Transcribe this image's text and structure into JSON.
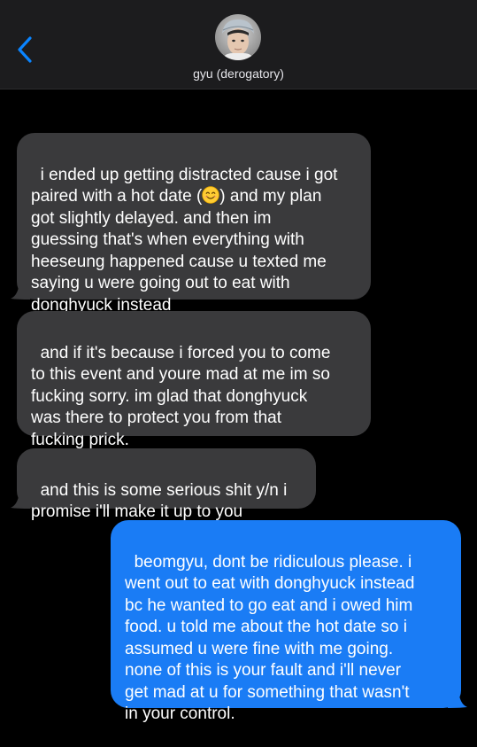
{
  "conversation": {
    "contact_name": "gyu (derogatory)"
  },
  "messages": [
    {
      "direction": "received",
      "text_before_emoji": "i ended up getting distracted cause i got\npaired with a hot date (",
      "emoji": "smiling-face",
      "text_after_emoji": ") and my plan\ngot slightly delayed. and then im\nguessing that's when everything with\nheeseung happened cause u texted me\nsaying u were going out to eat with\ndonghyuck instead"
    },
    {
      "direction": "received",
      "text": "and if it's because i forced you to come\nto this event and youre mad at me im so\nfucking sorry. im glad that donghyuck\nwas there to protect you from that\nfucking prick."
    },
    {
      "direction": "received",
      "text": "and this is some serious shit y/n i\npromise i'll make it up to you"
    },
    {
      "direction": "sent",
      "text": "beomgyu, dont be ridiculous please. i\nwent out to eat with donghyuck instead\nbc he wanted to go eat and i owed him\nfood. u told me about the hot date so i\nassumed u were fine with me going.\nnone of this is your fault and i'll never\nget mad at u for something that wasn't\nin your control."
    }
  ],
  "colors": {
    "received_bubble": "#3a3a3c",
    "sent_bubble": "#1a7cf5",
    "accent": "#0a84ff",
    "background": "#000000"
  }
}
